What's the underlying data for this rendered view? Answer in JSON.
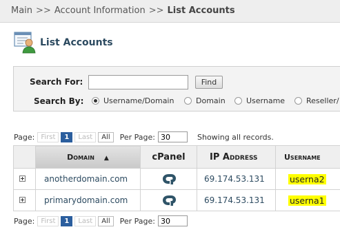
{
  "breadcrumb": {
    "items": [
      "Main",
      "Account Information",
      "List Accounts"
    ],
    "separator": ">>"
  },
  "page": {
    "title": "List Accounts"
  },
  "search": {
    "search_for_label": "Search For:",
    "search_input_value": "",
    "find_button": "Find",
    "search_by_label": "Search By:",
    "options": [
      "Username/Domain",
      "Domain",
      "Username",
      "Reseller/"
    ],
    "selected_index": 0
  },
  "pager_top": {
    "page_label": "Page:",
    "first": "First",
    "current_page": "1",
    "last": "Last",
    "all": "All",
    "per_page_label": "Per Page:",
    "per_page_value": "30",
    "status_text": "Showing all records."
  },
  "pager_bottom": {
    "page_label": "Page:",
    "first": "First",
    "current_page": "1",
    "last": "Last",
    "all": "All",
    "per_page_label": "Per Page:",
    "per_page_value": "30"
  },
  "table": {
    "headers": {
      "domain": "Domain",
      "cpanel": "cPanel",
      "ip": "IP Address",
      "username": "Username"
    },
    "rows": [
      {
        "domain": "anotherdomain.com",
        "ip": "69.174.53.131",
        "username": "userna2"
      },
      {
        "domain": "primarydomain.com",
        "ip": "69.174.53.131",
        "username": "userna1"
      }
    ]
  },
  "colors": {
    "accent": "#2c4a60",
    "highlight": "#ffff00",
    "active_page": "#2b5e9e"
  }
}
